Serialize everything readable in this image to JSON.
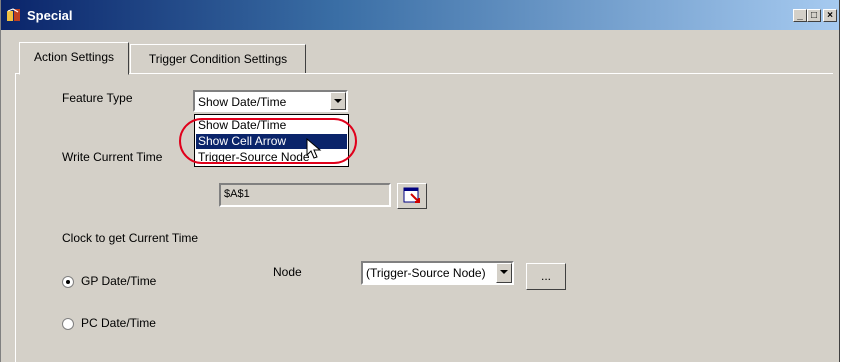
{
  "window": {
    "title": "Special",
    "icons": {
      "app": "tools-icon",
      "minimize": "minimize-icon",
      "maximize": "maximize-icon",
      "close": "close-icon"
    }
  },
  "tabs": [
    {
      "label": "Action Settings",
      "active": true
    },
    {
      "label": "Trigger Condition Settings",
      "active": false
    }
  ],
  "form": {
    "feature_type_label": "Feature Type",
    "feature_type_value": "Show Date/Time",
    "dropdown_options": [
      "Show Date/Time",
      "Show Cell Arrow",
      "Trigger-Source Node"
    ],
    "dropdown_selected": "Show Cell Arrow",
    "write_time_label": "Write Current Time",
    "cell_value": "$A$1",
    "clock_label": "Clock to get Current Time",
    "gp_radio_label": "GP Date/Time",
    "pc_radio_label": "PC Date/Time",
    "node_label": "Node",
    "node_value": "(Trigger-Source Node)",
    "browse_button_label": "..."
  },
  "colors": {
    "highlight": "#e0001b",
    "selection": "#0a246a"
  }
}
